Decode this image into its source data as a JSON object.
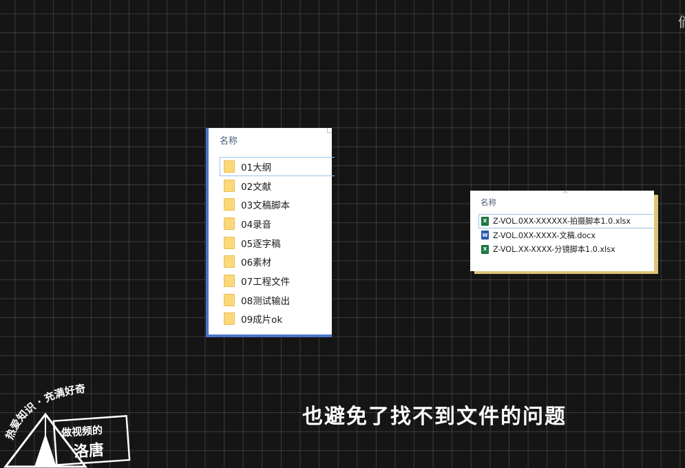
{
  "corner_text": "倘",
  "folder_panel": {
    "column_header": "名称",
    "items": [
      {
        "label": "01大纲",
        "selected": true
      },
      {
        "label": "02文献"
      },
      {
        "label": "03文稿脚本"
      },
      {
        "label": "04录音"
      },
      {
        "label": "05逐字稿"
      },
      {
        "label": "06素材"
      },
      {
        "label": "07工程文件"
      },
      {
        "label": "08测试输出"
      },
      {
        "label": "09成片ok"
      }
    ]
  },
  "file_panel": {
    "column_header": "名称",
    "sort_indicator": "^",
    "items": [
      {
        "label": "Z-VOL.0XX-XXXXXX-拍摄脚本1.0.xlsx",
        "type": "xlsx",
        "icon_glyph": "X",
        "selected": true
      },
      {
        "label": "Z-VOL.0XX-XXXX-文稿.docx",
        "type": "docx",
        "icon_glyph": "W"
      },
      {
        "label": "Z-VOL.XX-XXXX-分镜脚本1.0.xlsx",
        "type": "xlsx",
        "icon_glyph": "X"
      }
    ]
  },
  "subtitle": "也避免了找不到文件的问题",
  "logo": {
    "arc_text": "热爱知识 · 充满好奇",
    "line1": "做视频的",
    "line2": "洛唐"
  },
  "colors": {
    "background": "#151515",
    "folder_panel_accent": "#4d74c9",
    "file_panel_shadow": "#dfc478",
    "selection_border": "#99c3ec",
    "folder_icon": "#fbd87b",
    "xlsx_icon": "#1e7d45",
    "docx_icon": "#2b5fb3"
  }
}
